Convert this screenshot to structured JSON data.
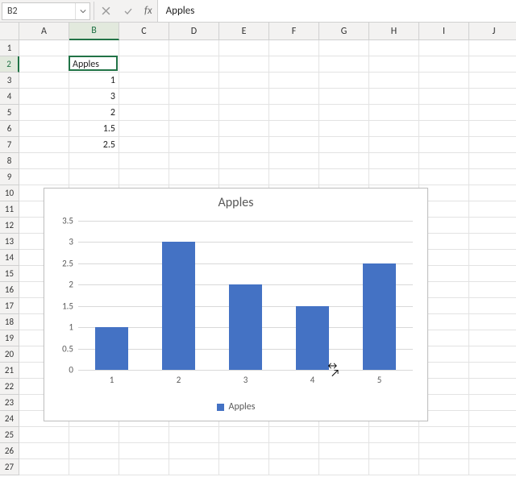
{
  "formula_bar": {
    "cell_ref": "B2",
    "fx_label": "fx",
    "formula_value": "Apples"
  },
  "grid": {
    "columns": [
      "A",
      "B",
      "C",
      "D",
      "E",
      "F",
      "G",
      "H",
      "I",
      "J"
    ],
    "row_count": 27,
    "active_cell": "B2",
    "cells": {
      "B2": "Apples",
      "B3": "1",
      "B4": "3",
      "B5": "2",
      "B6": "1.5",
      "B7": "2.5"
    }
  },
  "chart_data": {
    "type": "bar",
    "title": "Apples",
    "categories": [
      "1",
      "2",
      "3",
      "4",
      "5"
    ],
    "values": [
      1,
      3,
      2,
      1.5,
      2.5
    ],
    "y_ticks": [
      0,
      0.5,
      1,
      1.5,
      2,
      2.5,
      3,
      3.5
    ],
    "ylim": [
      0,
      3.5
    ],
    "legend": "Apples",
    "bar_color": "#4472c4"
  }
}
